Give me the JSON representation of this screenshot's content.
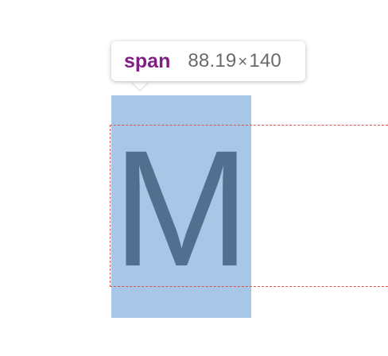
{
  "tooltip": {
    "tag": "span",
    "width": "88.19",
    "times": "×",
    "height": "140"
  },
  "element": {
    "text": "M"
  },
  "colors": {
    "highlight": "#a8c6e6",
    "glyph": "#536f8f",
    "line_box_border": "#d9534f",
    "tag": "#7f1f85",
    "dims": "#6a6a6a"
  }
}
